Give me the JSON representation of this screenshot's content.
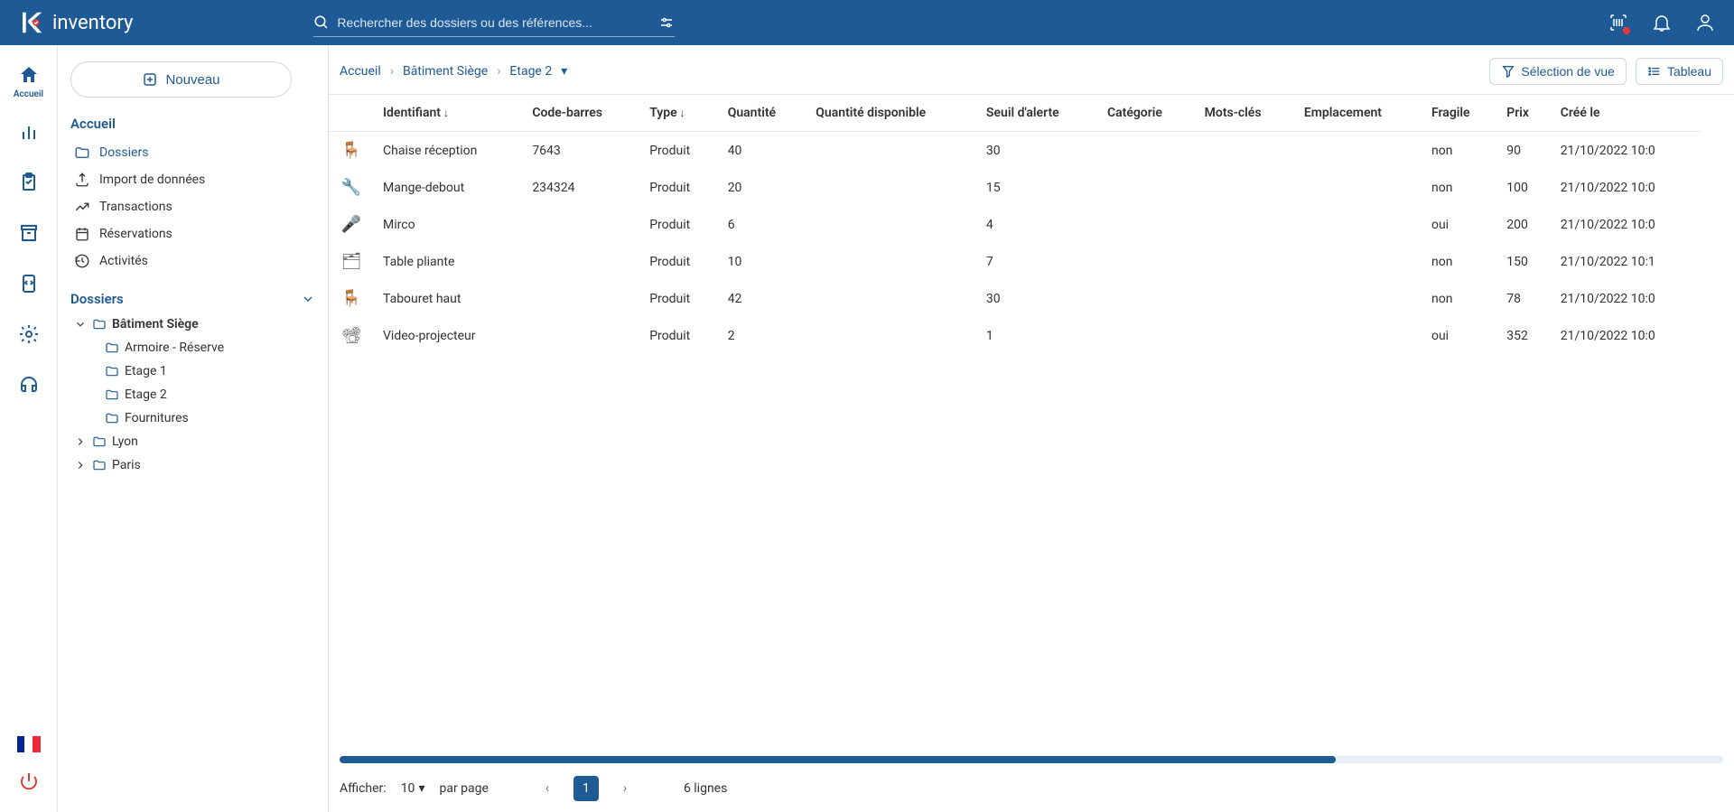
{
  "app": {
    "name": "inventory"
  },
  "search": {
    "placeholder": "Rechercher des dossiers ou des références..."
  },
  "rail": {
    "home_label": "Accueil"
  },
  "sidebar": {
    "new_button": "Nouveau",
    "section1_title": "Accueil",
    "links": {
      "dossiers": "Dossiers",
      "import": "Import de données",
      "transactions": "Transactions",
      "reservations": "Réservations",
      "activites": "Activités"
    },
    "section2_title": "Dossiers",
    "tree": {
      "batiment": "Bâtiment Siège",
      "armoire": "Armoire - Réserve",
      "etage1": "Etage 1",
      "etage2": "Etage 2",
      "fournitures": "Fournitures",
      "lyon": "Lyon",
      "paris": "Paris"
    }
  },
  "breadcrumb": {
    "home": "Accueil",
    "batiment": "Bâtiment Siège",
    "etage2": "Etage 2"
  },
  "view_buttons": {
    "selection": "Sélection de vue",
    "tableau": "Tableau"
  },
  "table": {
    "columns": {
      "identifiant": "Identifiant",
      "code_barres": "Code-barres",
      "type": "Type",
      "quantite": "Quantité",
      "quantite_dispo": "Quantité disponible",
      "seuil": "Seuil d'alerte",
      "categorie": "Catégorie",
      "mots_cles": "Mots-clés",
      "emplacement": "Emplacement",
      "fragile": "Fragile",
      "prix": "Prix",
      "cree_le": "Créé le"
    },
    "rows": [
      {
        "icon": "🪑",
        "identifiant": "Chaise réception",
        "code_barres": "7643",
        "type": "Produit",
        "quantite": "40",
        "seuil": "30",
        "fragile": "non",
        "prix": "90",
        "cree_le": "21/10/2022 10:0"
      },
      {
        "icon": "🔧",
        "identifiant": "Mange-debout",
        "code_barres": "234324",
        "type": "Produit",
        "quantite": "20",
        "seuil": "15",
        "fragile": "non",
        "prix": "100",
        "cree_le": "21/10/2022 10:0"
      },
      {
        "icon": "🎤",
        "identifiant": "Mirco",
        "code_barres": "",
        "type": "Produit",
        "quantite": "6",
        "seuil": "4",
        "fragile": "oui",
        "prix": "200",
        "cree_le": "21/10/2022 10:0"
      },
      {
        "icon": "🗂",
        "identifiant": "Table pliante",
        "code_barres": "",
        "type": "Produit",
        "quantite": "10",
        "seuil": "7",
        "fragile": "non",
        "prix": "150",
        "cree_le": "21/10/2022 10:1"
      },
      {
        "icon": "🪑",
        "identifiant": "Tabouret haut",
        "code_barres": "",
        "type": "Produit",
        "quantite": "42",
        "seuil": "30",
        "fragile": "non",
        "prix": "78",
        "cree_le": "21/10/2022 10:0"
      },
      {
        "icon": "📽",
        "identifiant": "Video-projecteur",
        "code_barres": "",
        "type": "Produit",
        "quantite": "2",
        "seuil": "1",
        "fragile": "oui",
        "prix": "352",
        "cree_le": "21/10/2022 10:0"
      }
    ]
  },
  "pager": {
    "afficher": "Afficher:",
    "page_size": "10",
    "par_page": "par page",
    "current": "1",
    "total_lines": "6 lignes"
  }
}
